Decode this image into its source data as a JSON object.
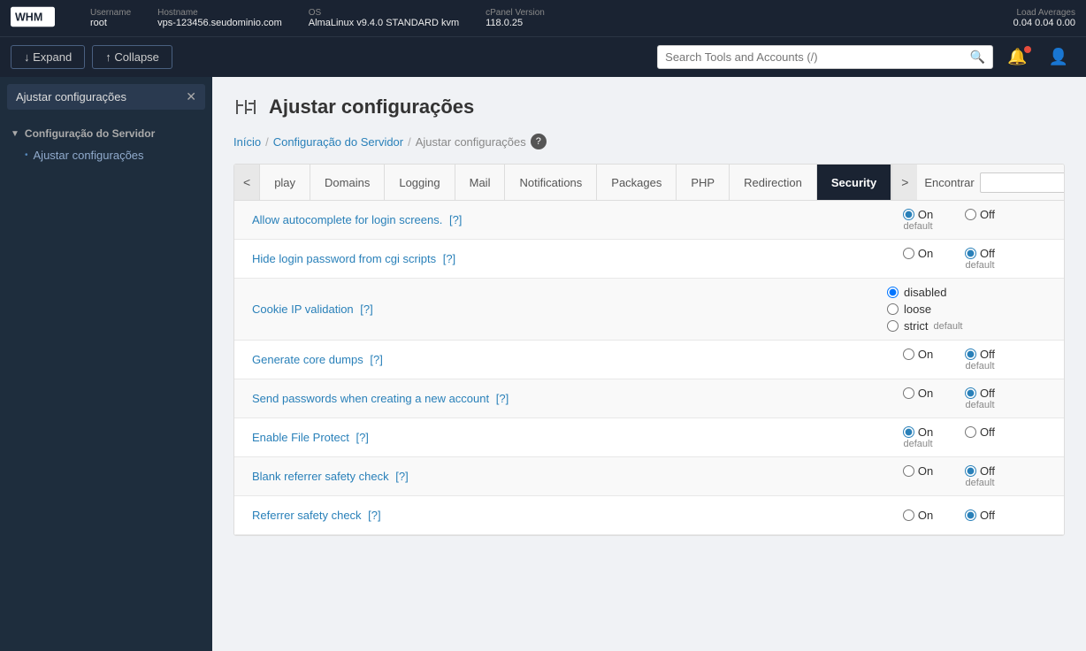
{
  "topbar": {
    "username_label": "Username",
    "hostname_label": "Hostname",
    "os_label": "OS",
    "cpanel_label": "cPanel Version",
    "load_label": "Load Averages",
    "username": "root",
    "hostname": "vps-123456.seudominio.com",
    "os": "AlmaLinux v9.4.0 STANDARD kvm",
    "cpanel_version": "118.0.25",
    "load": "0.04  0.04  0.00"
  },
  "actionbar": {
    "expand_label": "↓ Expand",
    "collapse_label": "↑ Collapse",
    "search_placeholder": "Search Tools and Accounts (/)"
  },
  "sidebar": {
    "tag_label": "Ajustar configurações",
    "section_title": "Configuração do Servidor",
    "items": [
      {
        "label": "Ajustar configurações"
      }
    ]
  },
  "page": {
    "title": "Ajustar configurações",
    "breadcrumb_home": "Início",
    "breadcrumb_sep1": "/",
    "breadcrumb_section": "Configuração do Servidor",
    "breadcrumb_sep2": "/",
    "breadcrumb_current": "Ajustar configurações"
  },
  "tabs": {
    "prev_label": "<",
    "next_label": ">",
    "items": [
      {
        "label": "play",
        "active": false
      },
      {
        "label": "Domains",
        "active": false
      },
      {
        "label": "Logging",
        "active": false
      },
      {
        "label": "Mail",
        "active": false
      },
      {
        "label": "Notifications",
        "active": false
      },
      {
        "label": "Packages",
        "active": false
      },
      {
        "label": "PHP",
        "active": false
      },
      {
        "label": "Redirection",
        "active": false
      },
      {
        "label": "Security",
        "active": true
      }
    ],
    "search_label": "Encontrar",
    "search_placeholder": ""
  },
  "settings": [
    {
      "label": "Allow autocomplete for login screens.",
      "help": "[?]",
      "on_selected": true,
      "off_selected": false,
      "on_default": true,
      "off_default": false,
      "type": "on_off"
    },
    {
      "label": "Hide login password from cgi scripts",
      "help": "[?]",
      "on_selected": false,
      "off_selected": true,
      "on_default": false,
      "off_default": true,
      "type": "on_off"
    },
    {
      "label": "Cookie IP validation",
      "help": "[?]",
      "type": "three",
      "options": [
        "disabled",
        "loose",
        "strict"
      ],
      "selected": "disabled",
      "default_option": "strict"
    },
    {
      "label": "Generate core dumps",
      "help": "[?]",
      "on_selected": false,
      "off_selected": true,
      "on_default": false,
      "off_default": true,
      "type": "on_off"
    },
    {
      "label": "Send passwords when creating a new account",
      "help": "[?]",
      "on_selected": false,
      "off_selected": true,
      "on_default": false,
      "off_default": true,
      "type": "on_off"
    },
    {
      "label": "Enable File Protect",
      "help": "[?]",
      "on_selected": true,
      "off_selected": false,
      "on_default": true,
      "off_default": false,
      "type": "on_off"
    },
    {
      "label": "Blank referrer safety check",
      "help": "[?]",
      "on_selected": false,
      "off_selected": true,
      "on_default": false,
      "off_default": true,
      "type": "on_off"
    },
    {
      "label": "Referrer safety check",
      "help": "[?]",
      "on_selected": false,
      "off_selected": true,
      "on_default": false,
      "off_default": true,
      "type": "on_off"
    }
  ]
}
